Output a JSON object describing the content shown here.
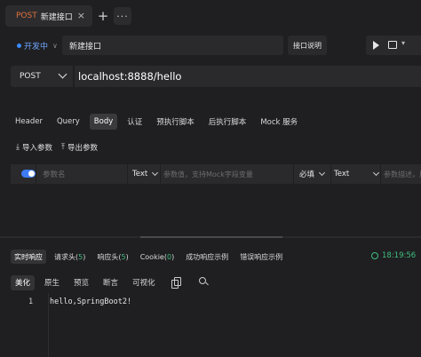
{
  "tab": {
    "method": "POST",
    "title": "新建接口",
    "close": "×",
    "new": "+",
    "more": "···"
  },
  "request": {
    "status": "开发中",
    "name": "新建接口",
    "doc_button": "接口说明",
    "method": "POST",
    "url": "localhost:8888/hello"
  },
  "request_tabs": [
    "Header",
    "Query",
    "Body",
    "认证",
    "预执行脚本",
    "后执行脚本",
    "Mock 服务"
  ],
  "request_active_tab": "Body",
  "param_actions": {
    "import": "导入参数",
    "export": "导出参数"
  },
  "param_row": {
    "name_placeholder": "参数名",
    "type": "Text",
    "value_placeholder": "参数值，支持Mock字段变量",
    "required": "必填",
    "field_type": "Text",
    "desc_placeholder": "参数描述，用"
  },
  "response_tabs": [
    {
      "label": "实时响应",
      "count": null
    },
    {
      "label": "请求头",
      "count": "5"
    },
    {
      "label": "响应头",
      "count": "5"
    },
    {
      "label": "Cookie",
      "count": "0"
    },
    {
      "label": "成功响应示例",
      "count": null
    },
    {
      "label": "错误响应示例",
      "count": null
    }
  ],
  "response_time": "18:19:56",
  "view_tabs": [
    "美化",
    "原生",
    "预览",
    "断言",
    "可视化"
  ],
  "code_lines": [
    {
      "no": "1",
      "text": "hello,SpringBoot2!"
    }
  ],
  "colors": {
    "accent": "#3e7bf5",
    "method": "#e0703a",
    "success": "#3fbf7f"
  }
}
